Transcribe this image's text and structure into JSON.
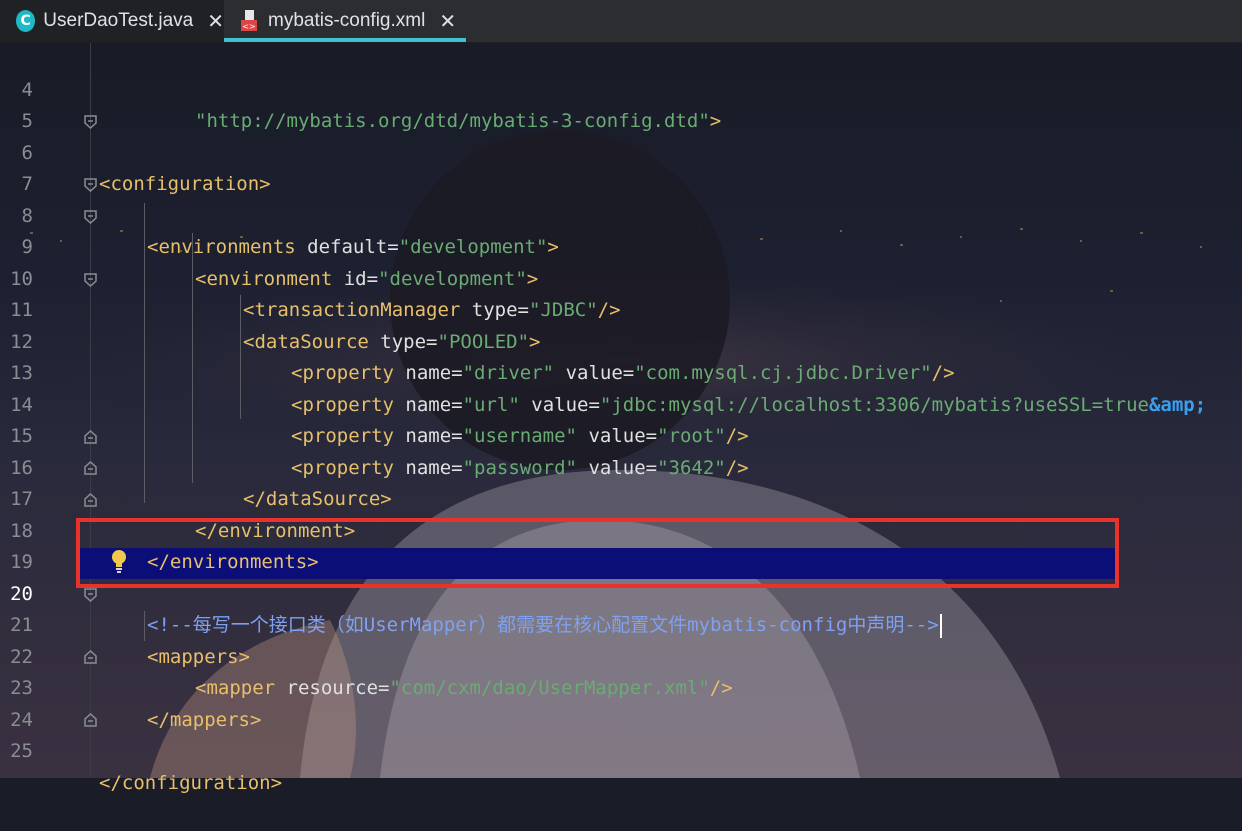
{
  "tabs": [
    {
      "label": "UserDaoTest.java",
      "icon": "java-class-icon",
      "active": false
    },
    {
      "label": "mybatis-config.xml",
      "icon": "xml-file-icon",
      "active": true
    }
  ],
  "close_glyph": "✕",
  "line_numbers": [
    "4",
    "5",
    "6",
    "7",
    "8",
    "9",
    "10",
    "11",
    "12",
    "13",
    "14",
    "15",
    "16",
    "17",
    "18",
    "19",
    "20",
    "21",
    "22",
    "23",
    "24",
    "25"
  ],
  "current_line": "20",
  "code": {
    "l4": {
      "s1": "\"http://mybatis.org/dtd/mybatis-3-config.dtd\"",
      "p1": ">"
    },
    "l6": {
      "t": "<configuration>"
    },
    "l8": {
      "t": "<environments",
      "a1": " default",
      "eq": "=",
      "s1": "\"development\"",
      "p1": ">"
    },
    "l9": {
      "t": "<environment",
      "a1": " id",
      "eq": "=",
      "s1": "\"development\"",
      "p1": ">"
    },
    "l10": {
      "t": "<transactionManager",
      "a1": " type",
      "eq": "=",
      "s1": "\"JDBC\"",
      "p1": "/>"
    },
    "l11": {
      "t": "<dataSource",
      "a1": " type",
      "eq": "=",
      "s1": "\"POOLED\"",
      "p1": ">"
    },
    "l12": {
      "t": "<property",
      "a1": " name",
      "eq": "=",
      "s1": "\"driver\"",
      "a2": " value",
      "eq2": "=",
      "s2": "\"com.mysql.cj.jdbc.Driver\"",
      "p1": "/>"
    },
    "l13": {
      "t": "<property",
      "a1": " name",
      "eq": "=",
      "s1": "\"url\"",
      "a2": " value",
      "eq2": "=",
      "s2": "\"jdbc:mysql://localhost:3306/mybatis?useSSL=true",
      "e": "&amp;"
    },
    "l14": {
      "t": "<property",
      "a1": " name",
      "eq": "=",
      "s1": "\"username\"",
      "a2": " value",
      "eq2": "=",
      "s2": "\"root\"",
      "p1": "/>"
    },
    "l15": {
      "t": "<property",
      "a1": " name",
      "eq": "=",
      "s1": "\"password\"",
      "a2": " value",
      "eq2": "=",
      "s2": "\"3642\"",
      "p1": "/>"
    },
    "l16": {
      "t": "</dataSource>"
    },
    "l17": {
      "t": "</environment>"
    },
    "l18": {
      "t": "</environments>"
    },
    "l20": {
      "c1": "<!--每写一个接口类（如",
      "c2": "UserMapper",
      "c3": "）都需要在核心配置文件",
      "c4": "mybatis-config",
      "c5": "中声明-->"
    },
    "l21": {
      "t": "<mappers>"
    },
    "l22": {
      "t": "<mapper",
      "a1": " resource",
      "eq": "=",
      "s1": "\"com/cxm/dao/UserMapper.xml\"",
      "p1": "/>"
    },
    "l23": {
      "t": "</mappers>"
    },
    "l25": {
      "t": "</configuration>"
    }
  },
  "colors": {
    "tag": "#e8bf6a",
    "attribute": "#e0e0e0",
    "string": "#6aab73",
    "comment": "#7ea1f2",
    "current_line_bg": "#0c0e77",
    "highlight_box": "#e8322b",
    "active_tab_underline": "#3ec1d3"
  }
}
